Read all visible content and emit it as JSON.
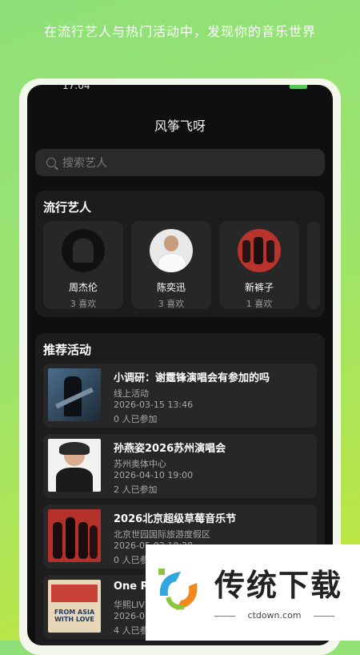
{
  "tagline": "在流行艺人与热门活动中，发现你的音乐世界",
  "status": {
    "time": "17:04"
  },
  "app": {
    "title": "风筝飞呀"
  },
  "search": {
    "placeholder": "搜索艺人"
  },
  "popular": {
    "title": "流行艺人",
    "artists": [
      {
        "name": "周杰伦",
        "likes": "3 喜欢"
      },
      {
        "name": "陈奕迅",
        "likes": "3 喜欢"
      },
      {
        "name": "新裤子",
        "likes": "1 喜欢"
      }
    ]
  },
  "recommend": {
    "title": "推荐活动",
    "events": [
      {
        "title": "小调研：谢霆锋演唱会有参加的吗",
        "location": "线上活动",
        "time": "2026-03-15 13:46",
        "count": "0 人已参加"
      },
      {
        "title": "孙燕姿2026苏州演唱会",
        "location": "苏州奥体中心",
        "time": "2026-04-10 19:00",
        "count": "2 人已参加"
      },
      {
        "title": "2026北京超级草莓音乐节",
        "location": "北京世园国际旅游度假区",
        "time": "2026-05-02 10:28",
        "count": "0 人已参加"
      },
      {
        "title": "One R",
        "location": "华熙LIV",
        "time": "2026-0",
        "count": "4 人已参"
      }
    ]
  },
  "watermark": {
    "brand": "传统下载",
    "url": "ctdown.com",
    "thumb_text": "FROM ASIA WITH LOVE"
  }
}
